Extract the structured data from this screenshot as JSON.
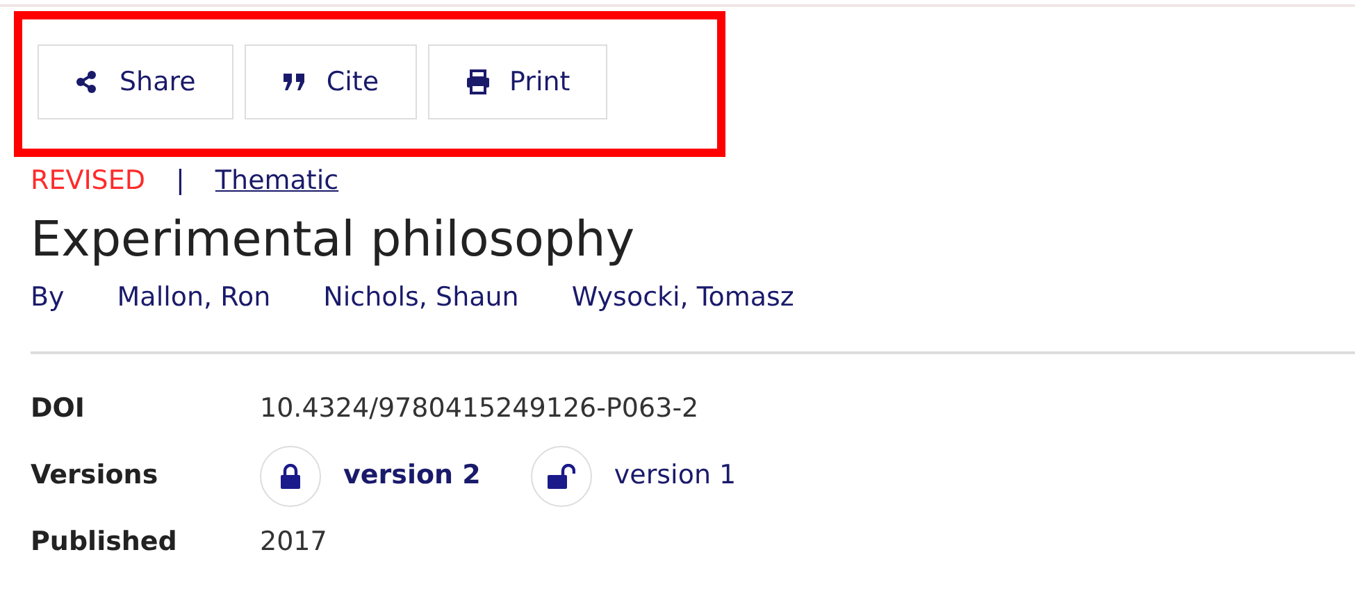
{
  "actions": [
    {
      "kind": "share",
      "label": "Share"
    },
    {
      "kind": "cite",
      "label": "Cite"
    },
    {
      "kind": "print",
      "label": "Print"
    }
  ],
  "status": {
    "state": "REVISED",
    "separator": "|",
    "type": "Thematic"
  },
  "title": "Experimental philosophy",
  "byline": {
    "label": "By",
    "authors": [
      "Mallon, Ron",
      "Nichols, Shaun",
      "Wysocki, Tomasz"
    ]
  },
  "details": [
    {
      "kind": "text",
      "label": "DOI",
      "value": "10.4324/9780415249126-P063-2"
    },
    {
      "kind": "versions",
      "label": "Versions",
      "versions": [
        {
          "label": "version 2",
          "selected": true,
          "locked": true
        },
        {
          "label": "version 1",
          "selected": false,
          "locked": false
        }
      ]
    },
    {
      "kind": "text",
      "label": "Published",
      "value": "2017"
    }
  ]
}
